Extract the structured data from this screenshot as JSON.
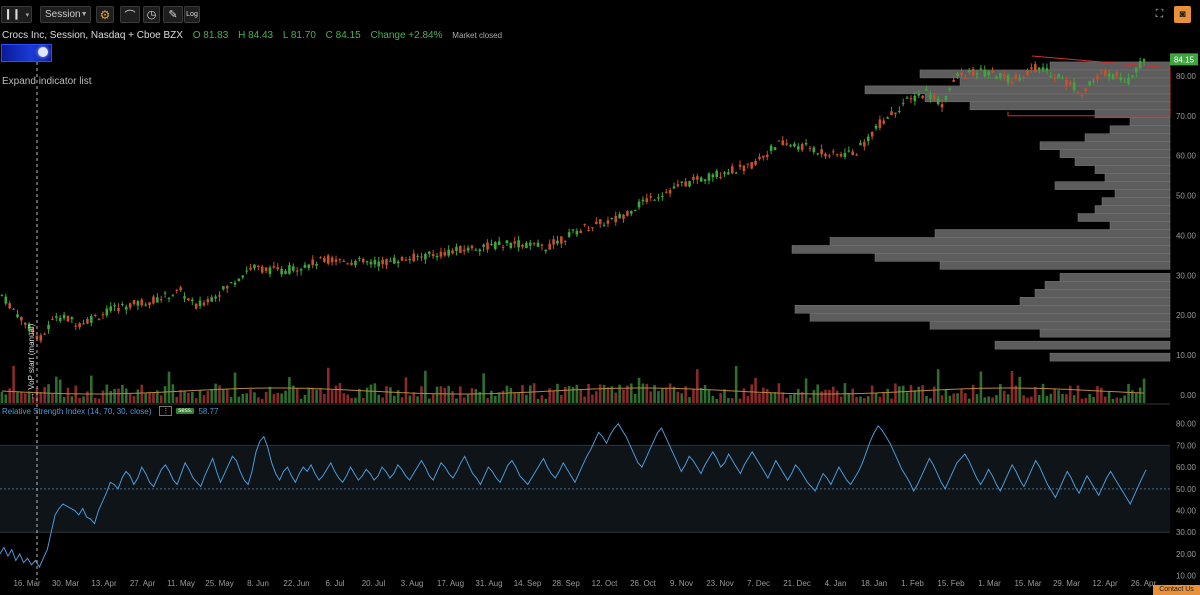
{
  "toolbar": {
    "chart_type_caret": "▾",
    "session_label": "Session",
    "log_label": "Log"
  },
  "symbol": {
    "name": "Crocs Inc, Session, Nasdaq + Cboe BZX",
    "open": "O 81.83",
    "high": "H 84.43",
    "low": "L 81.70",
    "close": "C 84.15",
    "change": "Change +2.84%",
    "status": "Market closed"
  },
  "expand_indicator": "Expand indicator list",
  "rsi_legend": {
    "title": "Relative Strength Index (14, 70, 30, close)",
    "sess_badge": "sess.",
    "value": "58.77"
  },
  "vap_label": "→ VoP start (manual)",
  "contact": "Contact Us",
  "colors": {
    "up": "#3fa63f",
    "down": "#c8502a",
    "vol_up": "#2f6e2f",
    "vol_down": "#8a2a2a",
    "rsi": "#4a9ad8",
    "profile": "#5d5d5d",
    "price_badge": "#3fa63f"
  },
  "chart_data": [
    {
      "type": "candlestick",
      "title": "Crocs Inc, Session, Nasdaq + Cboe BZX",
      "ylim": [
        -2,
        88
      ],
      "y_ticks": [
        "0.00",
        "10.00",
        "20.00",
        "30.00",
        "40.00",
        "50.00",
        "60.00",
        "70.00",
        "80.00"
      ],
      "last_price": "84.15",
      "x_ticks": [
        "16. Mar",
        "30. Mar",
        "13. Apr",
        "27. Apr",
        "11. May",
        "25. May",
        "8. Jun",
        "22. Jun",
        "6. Jul",
        "20. Jul",
        "3. Aug",
        "17. Aug",
        "31. Aug",
        "14. Sep",
        "28. Sep",
        "12. Oct",
        "26. Oct",
        "9. Nov",
        "23. Nov",
        "7. Dec",
        "21. Dec",
        "4. Jan",
        "18. Jan",
        "1. Feb",
        "15. Feb",
        "1. Mar",
        "15. Mar",
        "29. Mar",
        "12. Apr",
        "26. Apr"
      ],
      "price_path_keypoints": [
        [
          0,
          25
        ],
        [
          6,
          18
        ],
        [
          10,
          14
        ],
        [
          14,
          20
        ],
        [
          20,
          18
        ],
        [
          30,
          22
        ],
        [
          40,
          24
        ],
        [
          46,
          26
        ],
        [
          50,
          22
        ],
        [
          58,
          27
        ],
        [
          64,
          32
        ],
        [
          72,
          31
        ],
        [
          84,
          34
        ],
        [
          96,
          33
        ],
        [
          110,
          35
        ],
        [
          122,
          37
        ],
        [
          132,
          38
        ],
        [
          140,
          37
        ],
        [
          150,
          42
        ],
        [
          158,
          44
        ],
        [
          166,
          49
        ],
        [
          176,
          53
        ],
        [
          186,
          56
        ],
        [
          192,
          57
        ],
        [
          200,
          63
        ],
        [
          208,
          62
        ],
        [
          214,
          60
        ],
        [
          220,
          61
        ],
        [
          226,
          68
        ],
        [
          232,
          73
        ],
        [
          238,
          76
        ],
        [
          242,
          73
        ],
        [
          246,
          80
        ],
        [
          252,
          81
        ],
        [
          260,
          79
        ],
        [
          266,
          82
        ],
        [
          272,
          80
        ],
        [
          278,
          76
        ],
        [
          284,
          81
        ],
        [
          290,
          79
        ],
        [
          294,
          84.15
        ]
      ],
      "volume_profile": [
        {
          "price": 9.5,
          "volume": 120
        },
        {
          "price": 12.5,
          "volume": 175
        },
        {
          "price": 15.5,
          "volume": 130
        },
        {
          "price": 17.5,
          "volume": 240
        },
        {
          "price": 19.5,
          "volume": 360
        },
        {
          "price": 21.5,
          "volume": 375
        },
        {
          "price": 23.5,
          "volume": 150
        },
        {
          "price": 25.5,
          "volume": 135
        },
        {
          "price": 27.5,
          "volume": 125
        },
        {
          "price": 29.5,
          "volume": 110
        },
        {
          "price": 32.5,
          "volume": 230
        },
        {
          "price": 34.5,
          "volume": 295
        },
        {
          "price": 36.5,
          "volume": 378
        },
        {
          "price": 38.5,
          "volume": 340
        },
        {
          "price": 40.5,
          "volume": 235
        },
        {
          "price": 42.5,
          "volume": 60
        },
        {
          "price": 44.5,
          "volume": 92
        },
        {
          "price": 46.5,
          "volume": 75
        },
        {
          "price": 48.5,
          "volume": 68
        },
        {
          "price": 50.5,
          "volume": 55
        },
        {
          "price": 52.5,
          "volume": 115
        },
        {
          "price": 54.5,
          "volume": 65
        },
        {
          "price": 56.5,
          "volume": 75
        },
        {
          "price": 58.5,
          "volume": 95
        },
        {
          "price": 60.5,
          "volume": 110
        },
        {
          "price": 62.5,
          "volume": 130
        },
        {
          "price": 64.5,
          "volume": 85
        },
        {
          "price": 66.5,
          "volume": 60
        },
        {
          "price": 68.5,
          "volume": 40
        },
        {
          "price": 70.5,
          "volume": 75
        },
        {
          "price": 72.5,
          "volume": 200
        },
        {
          "price": 74.5,
          "volume": 245
        },
        {
          "price": 76.5,
          "volume": 305
        },
        {
          "price": 78.5,
          "volume": 210
        },
        {
          "price": 80.5,
          "volume": 250
        },
        {
          "price": 82.5,
          "volume": 120
        }
      ],
      "value_area": {
        "high": 82,
        "low": 70
      },
      "vap_start_x": "16. Mar"
    },
    {
      "type": "line",
      "title": "Relative Strength Index (14, 70, 30, close)",
      "ylim": [
        8,
        84
      ],
      "y_ticks": [
        "10.00",
        "20.00",
        "30.00",
        "40.00",
        "50.00",
        "60.00",
        "70.00",
        "80.00"
      ],
      "band": [
        30,
        70
      ],
      "midline": 50,
      "last_value": 58.77,
      "values": [
        20,
        23,
        19,
        22,
        17,
        20,
        16,
        18,
        15,
        17,
        14,
        18,
        22,
        30,
        38,
        41,
        43,
        42,
        41,
        40,
        38,
        41,
        37,
        36,
        34,
        40,
        44,
        48,
        53,
        52,
        50,
        55,
        58,
        56,
        52,
        55,
        60,
        57,
        53,
        51,
        55,
        59,
        61,
        58,
        54,
        52,
        57,
        62,
        59,
        55,
        53,
        51,
        56,
        60,
        64,
        58,
        53,
        57,
        61,
        65,
        63,
        58,
        54,
        52,
        58,
        67,
        72,
        74,
        69,
        62,
        57,
        54,
        58,
        60,
        56,
        53,
        57,
        60,
        58,
        61,
        57,
        54,
        56,
        59,
        62,
        58,
        55,
        53,
        56,
        60,
        57,
        54,
        56,
        59,
        57,
        54,
        56,
        60,
        58,
        55,
        57,
        61,
        59,
        56,
        54,
        57,
        60,
        63,
        60,
        56,
        54,
        58,
        62,
        60,
        57,
        55,
        58,
        62,
        65,
        61,
        57,
        55,
        52,
        56,
        60,
        58,
        55,
        53,
        57,
        61,
        63,
        60,
        56,
        54,
        52,
        55,
        58,
        61,
        64,
        60,
        57,
        55,
        58,
        62,
        59,
        56,
        53,
        57,
        61,
        65,
        68,
        72,
        76,
        74,
        71,
        75,
        78,
        80,
        77,
        74,
        70,
        66,
        62,
        60,
        64,
        68,
        72,
        76,
        78,
        74,
        70,
        66,
        62,
        58,
        61,
        65,
        63,
        60,
        57,
        61,
        64,
        67,
        64,
        60,
        62,
        66,
        63,
        60,
        57,
        61,
        64,
        67,
        64,
        61,
        58,
        55,
        59,
        63,
        60,
        57,
        54,
        57,
        61,
        59,
        56,
        53,
        51,
        49,
        53,
        57,
        55,
        52,
        56,
        60,
        57,
        54,
        52,
        55,
        58,
        62,
        67,
        72,
        76,
        79,
        77,
        74,
        71,
        67,
        63,
        59,
        56,
        53,
        49,
        52,
        56,
        60,
        64,
        61,
        57,
        53,
        50,
        54,
        58,
        62,
        64,
        66,
        63,
        59,
        55,
        52,
        55,
        59,
        56,
        52,
        49,
        53,
        57,
        61,
        58,
        54,
        51,
        55,
        59,
        63,
        60,
        56,
        52,
        49,
        46,
        50,
        54,
        58,
        55,
        51,
        48,
        52,
        56,
        53,
        50,
        47,
        51,
        55,
        58,
        55,
        52,
        49,
        46,
        43,
        47,
        51,
        55,
        58.77
      ]
    }
  ]
}
